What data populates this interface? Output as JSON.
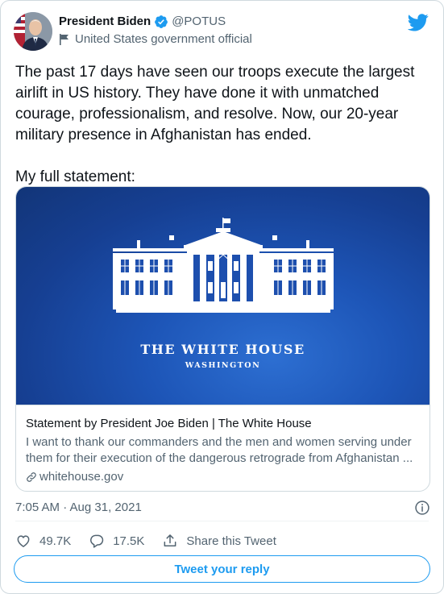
{
  "author": {
    "name": "President Biden",
    "handle": "@POTUS",
    "label": "United States government official",
    "verified": true
  },
  "tweet": {
    "paragraphs": [
      "The past 17 days have seen our troops execute the largest airlift in US history. They have done it with unmatched courage, professionalism, and resolve. Now, our 20-year military presence in Afghanistan has ended.",
      "My full statement:"
    ],
    "timestamp": "7:05 AM · Aug 31, 2021"
  },
  "link_card": {
    "image_title": "THE WHITE HOUSE",
    "image_subtitle": "WASHINGTON",
    "title": "Statement by President Joe Biden | The White House",
    "description": "I want to thank our commanders and the men and women serving under them for their execution of the dangerous retrograde from Afghanistan ...",
    "domain": "whitehouse.gov"
  },
  "actions": {
    "likes": "49.7K",
    "replies": "17.5K",
    "share_label": "Share this Tweet"
  },
  "reply_button": "Tweet your reply",
  "colors": {
    "accent": "#1d9bf0",
    "text": "#0f1419",
    "secondary": "#536471",
    "card_bg": "#1a4aa6"
  },
  "icons": [
    "verified-badge-icon",
    "government-flag-icon",
    "twitter-bird-icon",
    "link-icon",
    "info-icon",
    "heart-icon",
    "reply-bubble-icon",
    "share-icon"
  ]
}
